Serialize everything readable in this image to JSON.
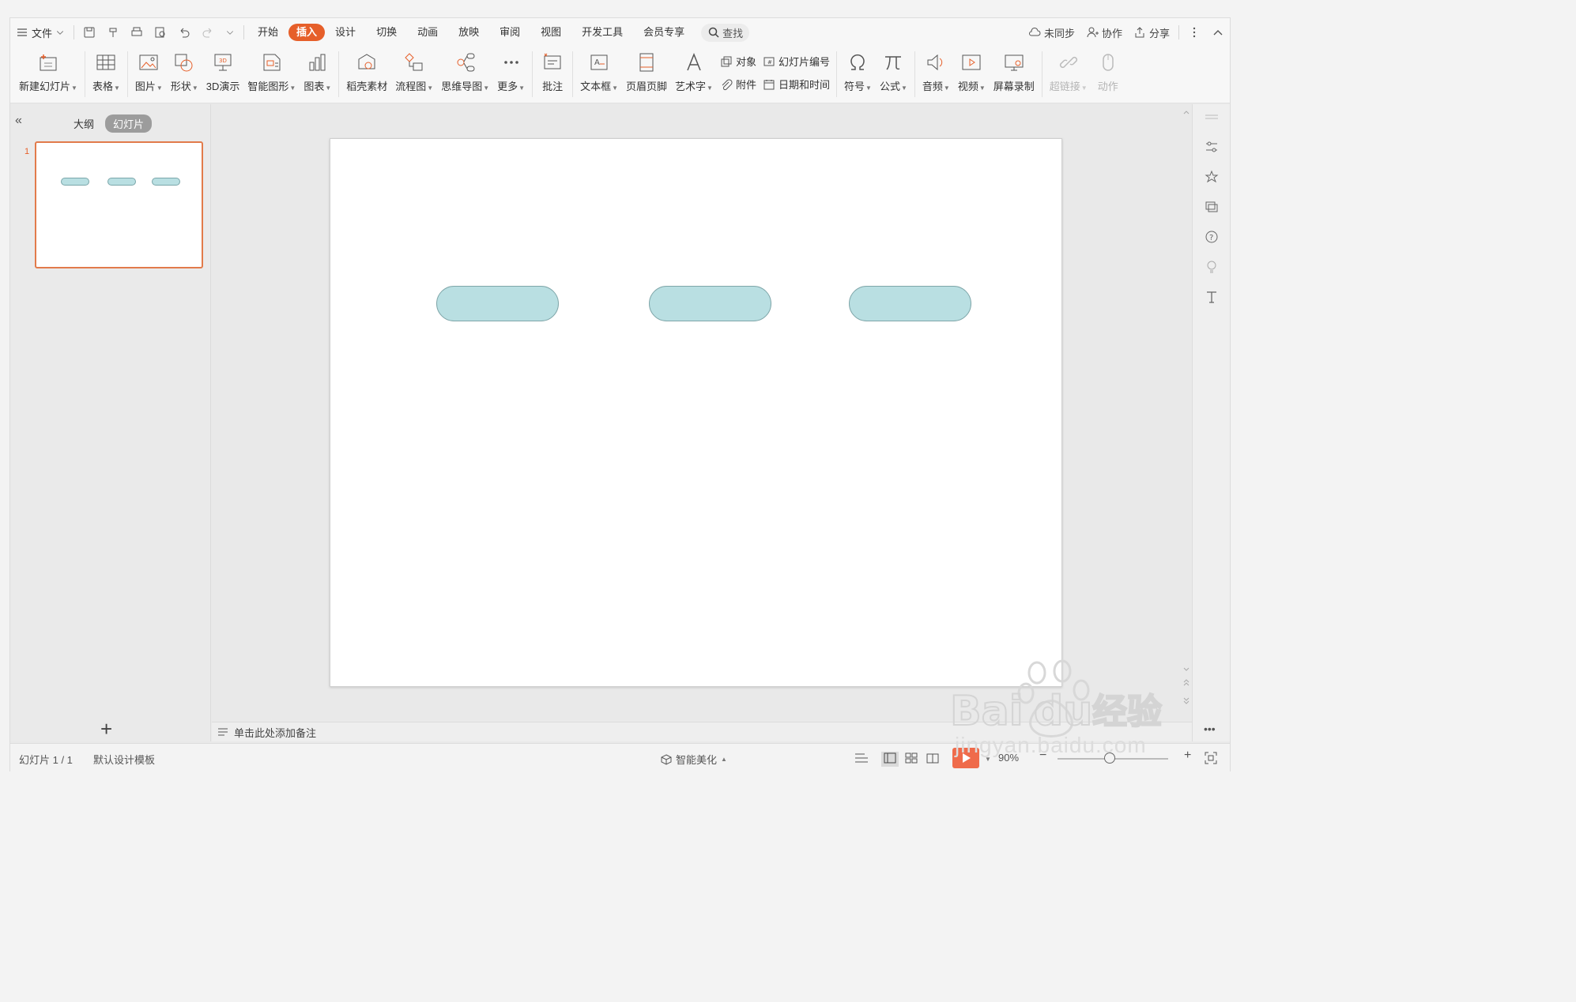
{
  "menubar": {
    "file_label": "文件",
    "tabs": [
      "开始",
      "插入",
      "设计",
      "切换",
      "动画",
      "放映",
      "审阅",
      "视图",
      "开发工具",
      "会员专享"
    ],
    "active_tab": "插入",
    "search_label": "查找",
    "sync_label": "未同步",
    "collab_label": "协作",
    "share_label": "分享"
  },
  "ribbon": {
    "new_slide": "新建幻灯片",
    "table": "表格",
    "picture": "图片",
    "shape": "形状",
    "demo3d": "3D演示",
    "smartart": "智能图形",
    "chart": "图表",
    "material": "稻壳素材",
    "flowchart": "流程图",
    "mindmap": "思维导图",
    "more": "更多",
    "comment": "批注",
    "textbox": "文本框",
    "header_footer": "页眉页脚",
    "wordart": "艺术字",
    "object": "对象",
    "attachment": "附件",
    "slide_number": "幻灯片编号",
    "datetime": "日期和时间",
    "symbol": "符号",
    "formula": "公式",
    "audio": "音频",
    "video": "视频",
    "screen_record": "屏幕录制",
    "hyperlink": "超链接",
    "action": "动作"
  },
  "left_panel": {
    "outline_tab": "大纲",
    "slides_tab": "幻灯片",
    "slide_number": "1"
  },
  "notes": {
    "placeholder": "单击此处添加备注"
  },
  "status": {
    "slide_counter": "幻灯片 1 / 1",
    "template": "默认设计模板",
    "beautify": "智能美化",
    "zoom": "90%"
  },
  "watermark": {
    "brand": "Baidu经验",
    "url": "jingyan.baidu.com"
  },
  "colors": {
    "accent": "#e65f2a",
    "pill_fill": "#b9dfe2",
    "pill_border": "#7fa6a9"
  }
}
